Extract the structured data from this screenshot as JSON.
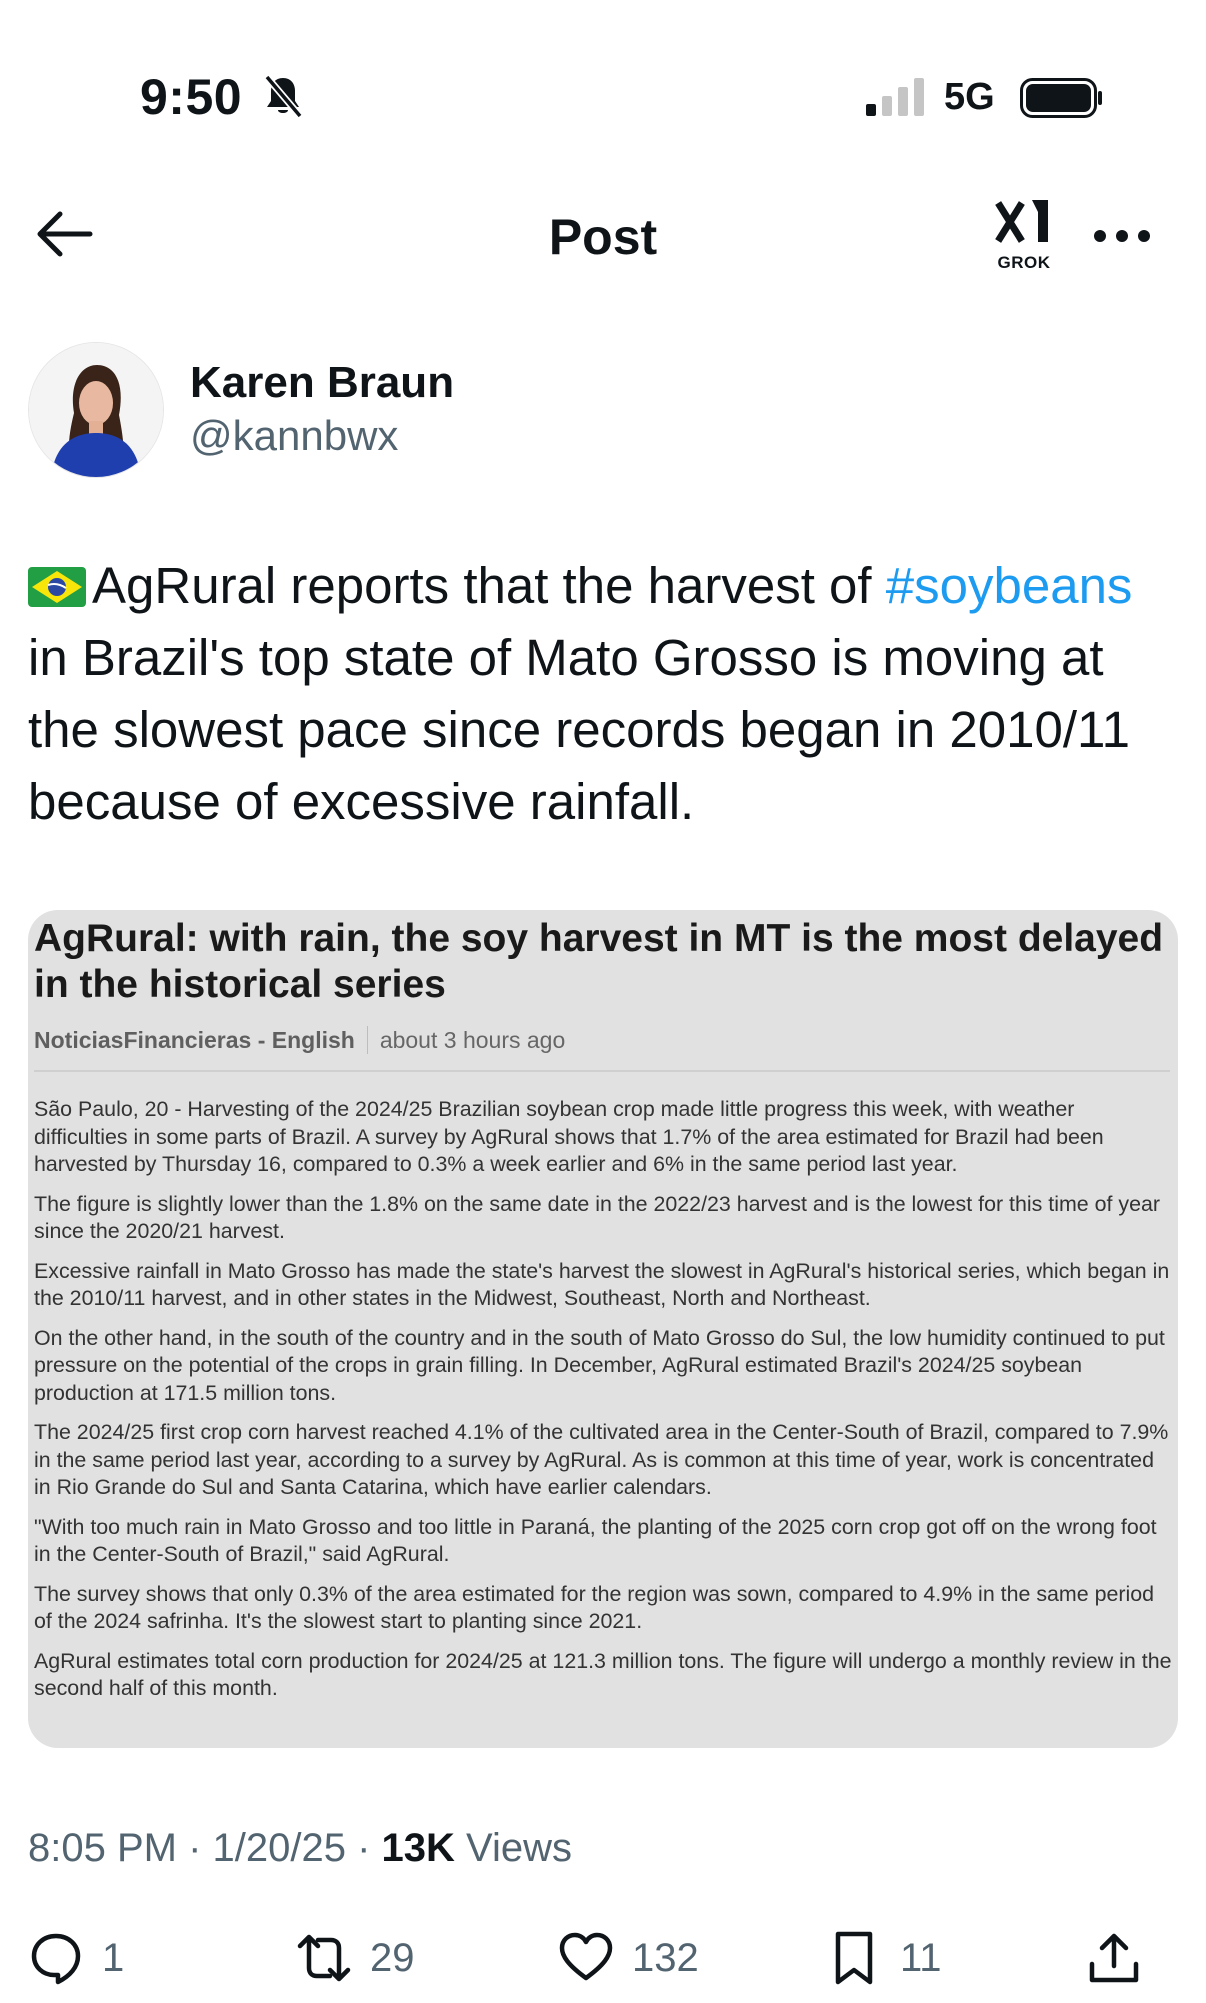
{
  "status_bar": {
    "time": "9:50",
    "network": "5G",
    "icons": [
      "bell-slash-icon",
      "signal-icon",
      "battery-icon"
    ]
  },
  "nav": {
    "title": "Post",
    "grok_label": "GROK",
    "icons": [
      "back-arrow-icon",
      "grok-icon",
      "more-icon"
    ]
  },
  "author": {
    "name": "Karen Braun",
    "handle": "@kannbwx"
  },
  "tweet": {
    "text_before": "AgRural reports that the harvest of ",
    "hashtag": "#soybeans",
    "text_after": " in Brazil's top state of Mato Grosso is moving at the slowest pace since records began in 2010/11 because of excessive rainfall.",
    "flag_icon": "brazil-flag-icon"
  },
  "article": {
    "title": "AgRural: with rain, the soy harvest in MT is the most delayed in the historical series",
    "source": "NoticiasFinancieras - English",
    "time_ago": "about 3 hours ago",
    "paragraphs": [
      "São Paulo, 20 - Harvesting of the 2024/25 Brazilian soybean crop made little progress this week, with weather difficulties in some parts of Brazil. A survey by AgRural shows that 1.7% of the area estimated for Brazil had been harvested by Thursday 16, compared to 0.3% a week earlier and 6% in the same period last year.",
      "The figure is slightly lower than the 1.8% on the same date in the 2022/23 harvest and is the lowest for this time of year since the 2020/21 harvest.",
      "Excessive rainfall in Mato Grosso has made the state's harvest the slowest in AgRural's historical series, which began in the 2010/11 harvest, and in other states in the Midwest, Southeast, North and Northeast.",
      "On the other hand, in the south of the country and in the south of Mato Grosso do Sul, the low humidity continued to put pressure on the potential of the crops in grain filling. In December, AgRural estimated Brazil's 2024/25 soybean production at 171.5 million tons.",
      "The 2024/25 first crop corn harvest reached 4.1% of the cultivated area in the Center-South of Brazil, compared to 7.9% in the same period last year, according to a survey by AgRural. As is common at this time of year, work is concentrated in Rio Grande do Sul and Santa Catarina, which have earlier calendars.",
      "\"With too much rain in Mato Grosso and too little in Paraná, the planting of the 2025 corn crop got off on the wrong foot in the Center-South of Brazil,\" said AgRural.",
      "The survey shows that only 0.3% of the area estimated for the region was sown, compared to 4.9% in the same period of the 2024 safrinha. It's the slowest start to planting since 2021.",
      "AgRural estimates total corn production for 2024/25 at 121.3 million tons. The figure will undergo a monthly review in the second half of this month."
    ]
  },
  "meta": {
    "time": "8:05 PM",
    "sep1": " · ",
    "date": "1/20/25",
    "sep2": " · ",
    "views_count": "13K",
    "views_label": " Views"
  },
  "actions": {
    "replies": "1",
    "reposts": "29",
    "likes": "132",
    "bookmarks": "11",
    "icons": [
      "reply-icon",
      "repost-icon",
      "like-icon",
      "bookmark-icon",
      "share-icon"
    ]
  },
  "colors": {
    "text": "#0f1419",
    "secondary": "#536471",
    "accent": "#1d9bf0",
    "article_bg": "#e1e1e1"
  }
}
